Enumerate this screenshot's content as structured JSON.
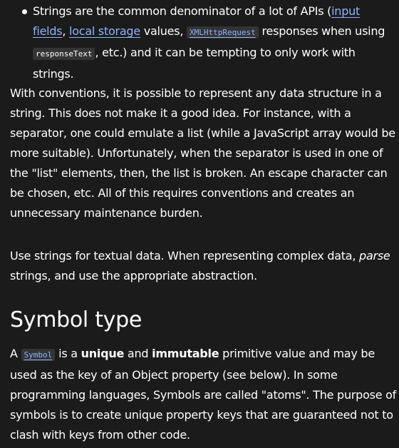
{
  "bullet": {
    "text_1": "Strings are the common denominator of a lot of APIs (",
    "link_input_fields": "input fields",
    "text_2": ", ",
    "link_local_storage": "local storage",
    "text_3": " values, ",
    "code_xmlhttprequest": "XMLHttpRequest",
    "text_4": " responses when using ",
    "code_responsetext": "responseText",
    "text_5": ", etc.) and it can be tempting to only work with strings."
  },
  "paragraph_conventions": "With conventions, it is possible to represent any data structure in a string. This does not make it a good idea. For instance, with a separator, one could emulate a list (while a JavaScript array would be more suitable). Unfortunately, when the separator is used in one of the \"list\" elements, then, the list is broken. An escape character can be chosen, etc. All of this requires conventions and creates an unnecessary maintenance burden.",
  "paragraph_use_strings": {
    "text_1": "Use strings for textual data. When representing complex data, ",
    "emphasis": "parse",
    "text_2": " strings, and use the appropriate abstraction."
  },
  "heading_symbol_type": "Symbol type",
  "paragraph_symbol": {
    "text_1": "A ",
    "code_symbol": "Symbol",
    "text_2": " is a ",
    "strong_unique": "unique",
    "text_3": " and ",
    "strong_immutable": "immutable",
    "text_4": " primitive value and may be used as the key of an Object property (see below). In some programming languages, Symbols are called \"atoms\". The purpose of symbols is to create unique property keys that are guaranteed not to clash with keys from other code."
  },
  "colors": {
    "background": "#1b1b1b",
    "text": "#ffffff",
    "link": "#8cb4ff",
    "code_background": "#343434"
  }
}
